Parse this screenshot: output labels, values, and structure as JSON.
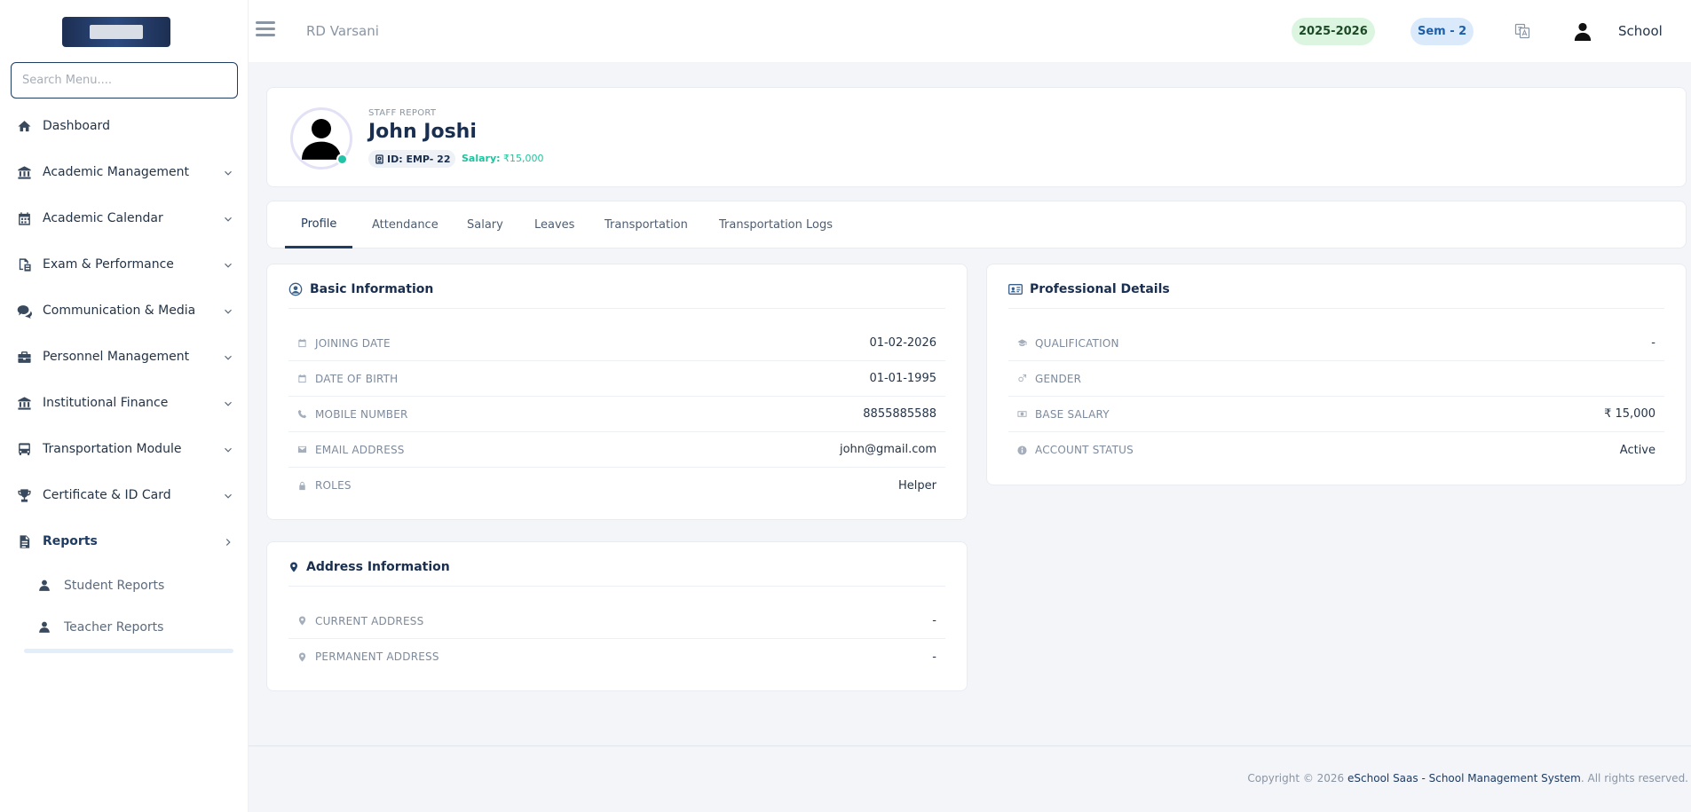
{
  "sidebar": {
    "search_placeholder": "Search Menu....",
    "items": [
      {
        "label": "Dashboard",
        "icon": "home-icon"
      },
      {
        "label": "Academic Management",
        "icon": "bank-icon"
      },
      {
        "label": "Academic Calendar",
        "icon": "calendar-icon"
      },
      {
        "label": "Exam & Performance",
        "icon": "documents-icon"
      },
      {
        "label": "Communication & Media",
        "icon": "chat-icon"
      },
      {
        "label": "Personnel Management",
        "icon": "briefcase-icon"
      },
      {
        "label": "Institutional Finance",
        "icon": "bank-icon"
      },
      {
        "label": "Transportation Module",
        "icon": "bus-icon"
      },
      {
        "label": "Certificate & ID Card",
        "icon": "trophy-icon"
      },
      {
        "label": "Reports",
        "icon": "report-icon"
      }
    ],
    "sub_items": [
      {
        "label": "Student Reports",
        "icon": "user-icon"
      },
      {
        "label": "Teacher Reports",
        "icon": "user-icon"
      }
    ]
  },
  "topbar": {
    "school_name": "RD Varsani",
    "session": "2025-2026",
    "semester": "Sem - 2",
    "user_name": "School"
  },
  "header": {
    "report_type": "STAFF REPORT",
    "name": "John Joshi",
    "emp_id": "ID: EMP- 22",
    "salary_label": "Salary:",
    "salary_value": "₹15,000"
  },
  "tabs": [
    "Profile",
    "Attendance",
    "Salary",
    "Leaves",
    "Transportation",
    "Transportation Logs"
  ],
  "basic_info": {
    "title": "Basic Information",
    "rows": [
      {
        "label": "JOINING DATE",
        "value": "01-02-2026",
        "icon": "calendar-icon"
      },
      {
        "label": "DATE OF BIRTH",
        "value": "01-01-1995",
        "icon": "calendar-icon"
      },
      {
        "label": "MOBILE NUMBER",
        "value": "8855885588",
        "icon": "phone-icon"
      },
      {
        "label": "EMAIL ADDRESS",
        "value": "john@gmail.com",
        "icon": "envelope-icon"
      },
      {
        "label": "ROLES",
        "value": "Helper",
        "icon": "lock-icon"
      }
    ]
  },
  "professional": {
    "title": "Professional Details",
    "rows": [
      {
        "label": "QUALIFICATION",
        "value": "-",
        "icon": "graduation-cap-icon"
      },
      {
        "label": "GENDER",
        "value": "",
        "icon": "gender-icon"
      },
      {
        "label": "BASE SALARY",
        "value": "₹ 15,000",
        "icon": "money-icon"
      },
      {
        "label": "ACCOUNT STATUS",
        "value": "Active",
        "icon": "info-icon"
      }
    ]
  },
  "address": {
    "title": "Address Information",
    "rows": [
      {
        "label": "CURRENT ADDRESS",
        "value": "-",
        "icon": "map-pin-icon"
      },
      {
        "label": "PERMANENT ADDRESS",
        "value": "-",
        "icon": "map-pin-icon"
      }
    ]
  },
  "footer": {
    "prefix": "Copyright © 2026",
    "link": "eSchool Saas - School Management System",
    "suffix": ". All rights reserved."
  },
  "colors": {
    "primary": "#1f3c63",
    "accent_green": "#20c39e",
    "session_badge_bg": "#dcf5e0",
    "semester_badge_bg": "#dbeafa"
  }
}
